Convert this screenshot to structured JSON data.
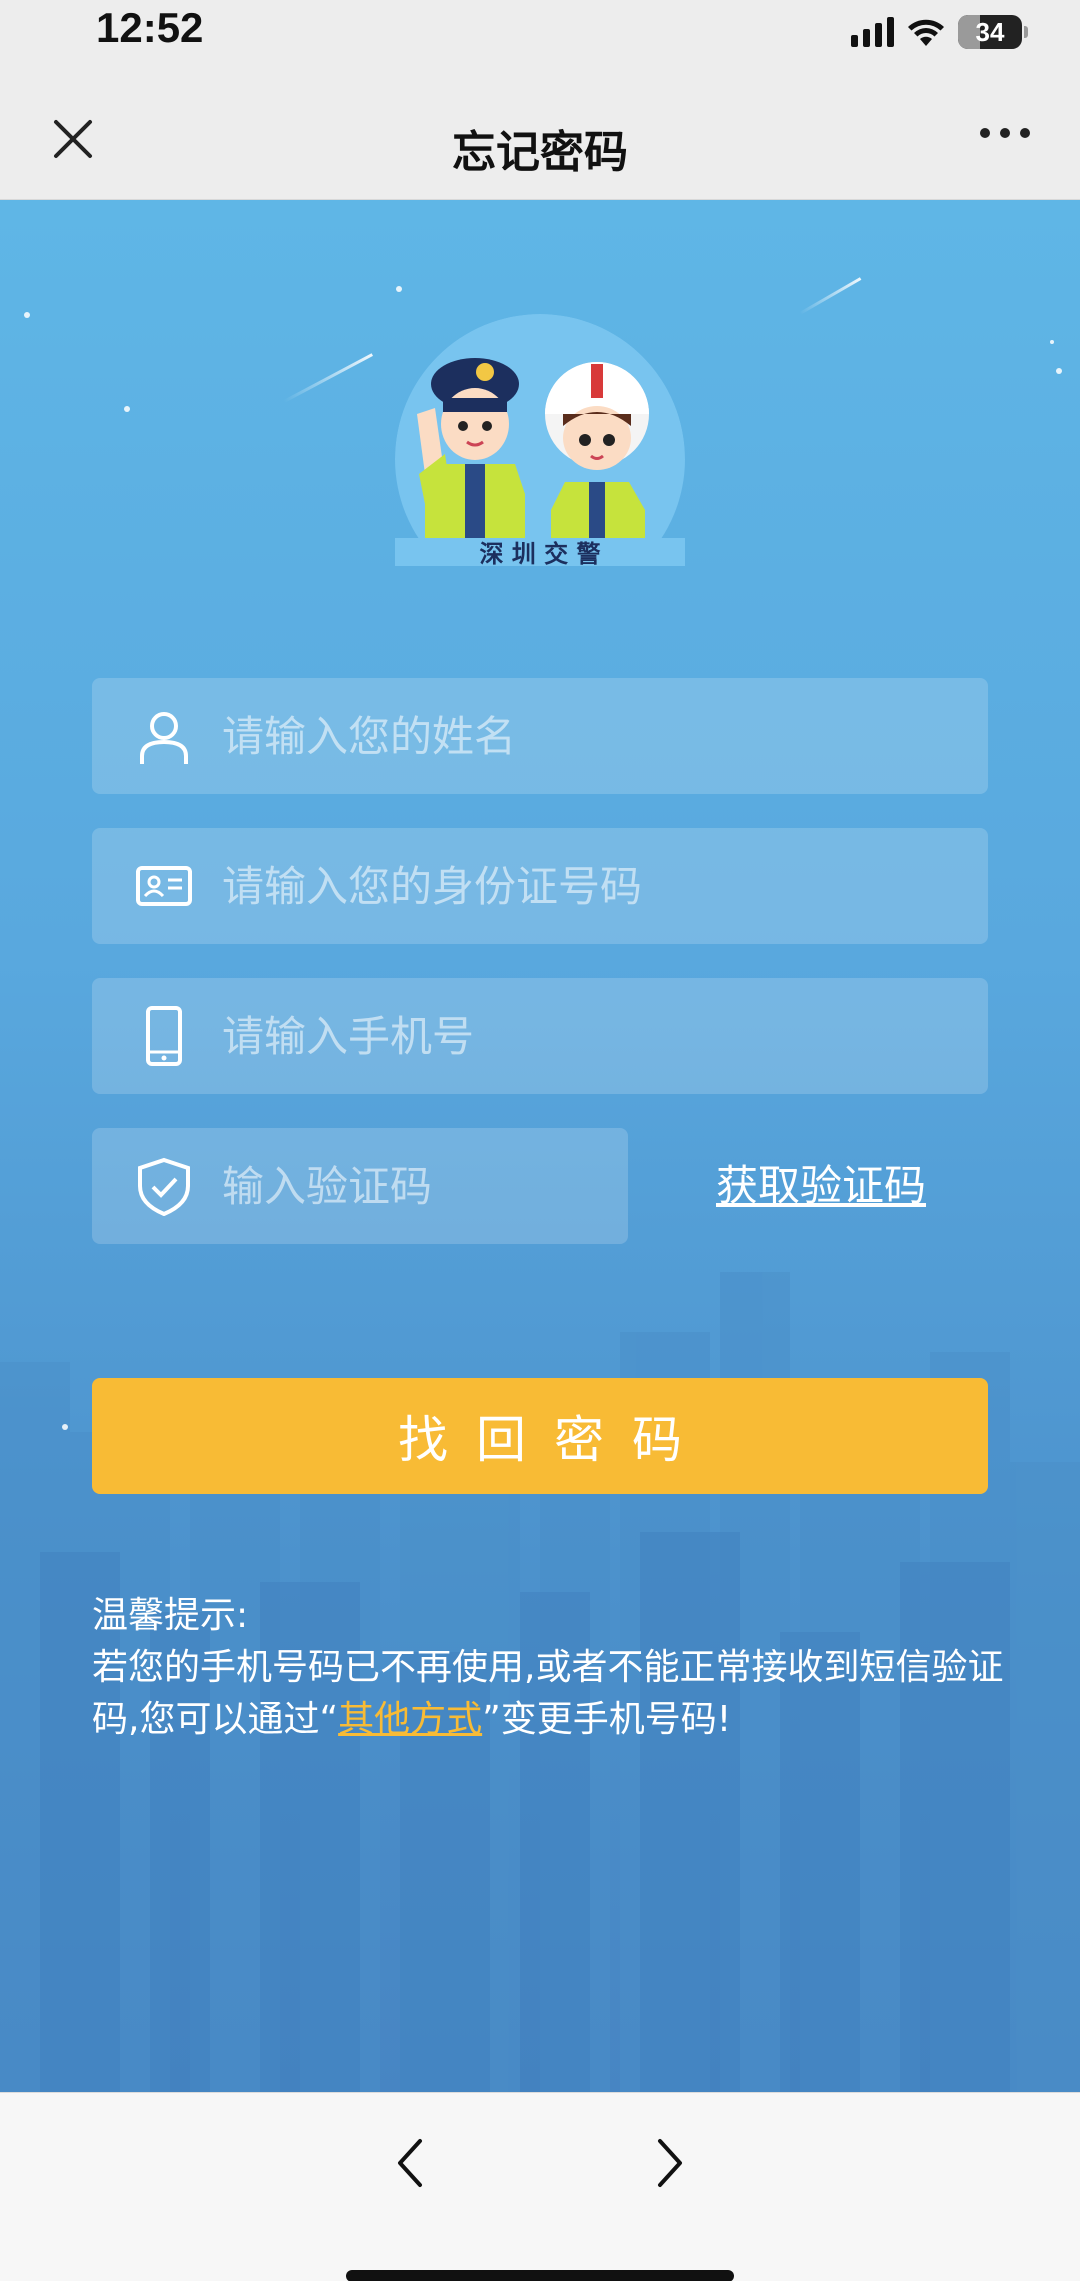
{
  "status_bar": {
    "time": "12:52",
    "battery_level": "34",
    "icons": [
      "signal-icon",
      "wifi-icon",
      "battery-icon"
    ]
  },
  "nav": {
    "title": "忘记密码",
    "close_icon": "close-icon",
    "more_icon": "more-icon"
  },
  "logo": {
    "caption": "深 圳 交 警"
  },
  "form": {
    "name_placeholder": "请输入您的姓名",
    "id_placeholder": "请输入您的身份证号码",
    "phone_placeholder": "请输入手机号",
    "code_placeholder": "输入验证码",
    "get_code_label": "获取验证码",
    "submit_label": "找回密码"
  },
  "tips": {
    "heading": "温馨提示:",
    "text_before": "若您的手机号码已不再使用,或者不能正常接收到短信验证码,您可以通过“",
    "link_label": "其他方式",
    "text_after": "”变更手机号码!"
  },
  "toolbar": {
    "back_icon": "chevron-left-icon",
    "forward_icon": "chevron-right-icon"
  },
  "colors": {
    "accent": "#f8bb35",
    "background_top": "#5fb6e6",
    "background_bottom": "#4785c3"
  }
}
